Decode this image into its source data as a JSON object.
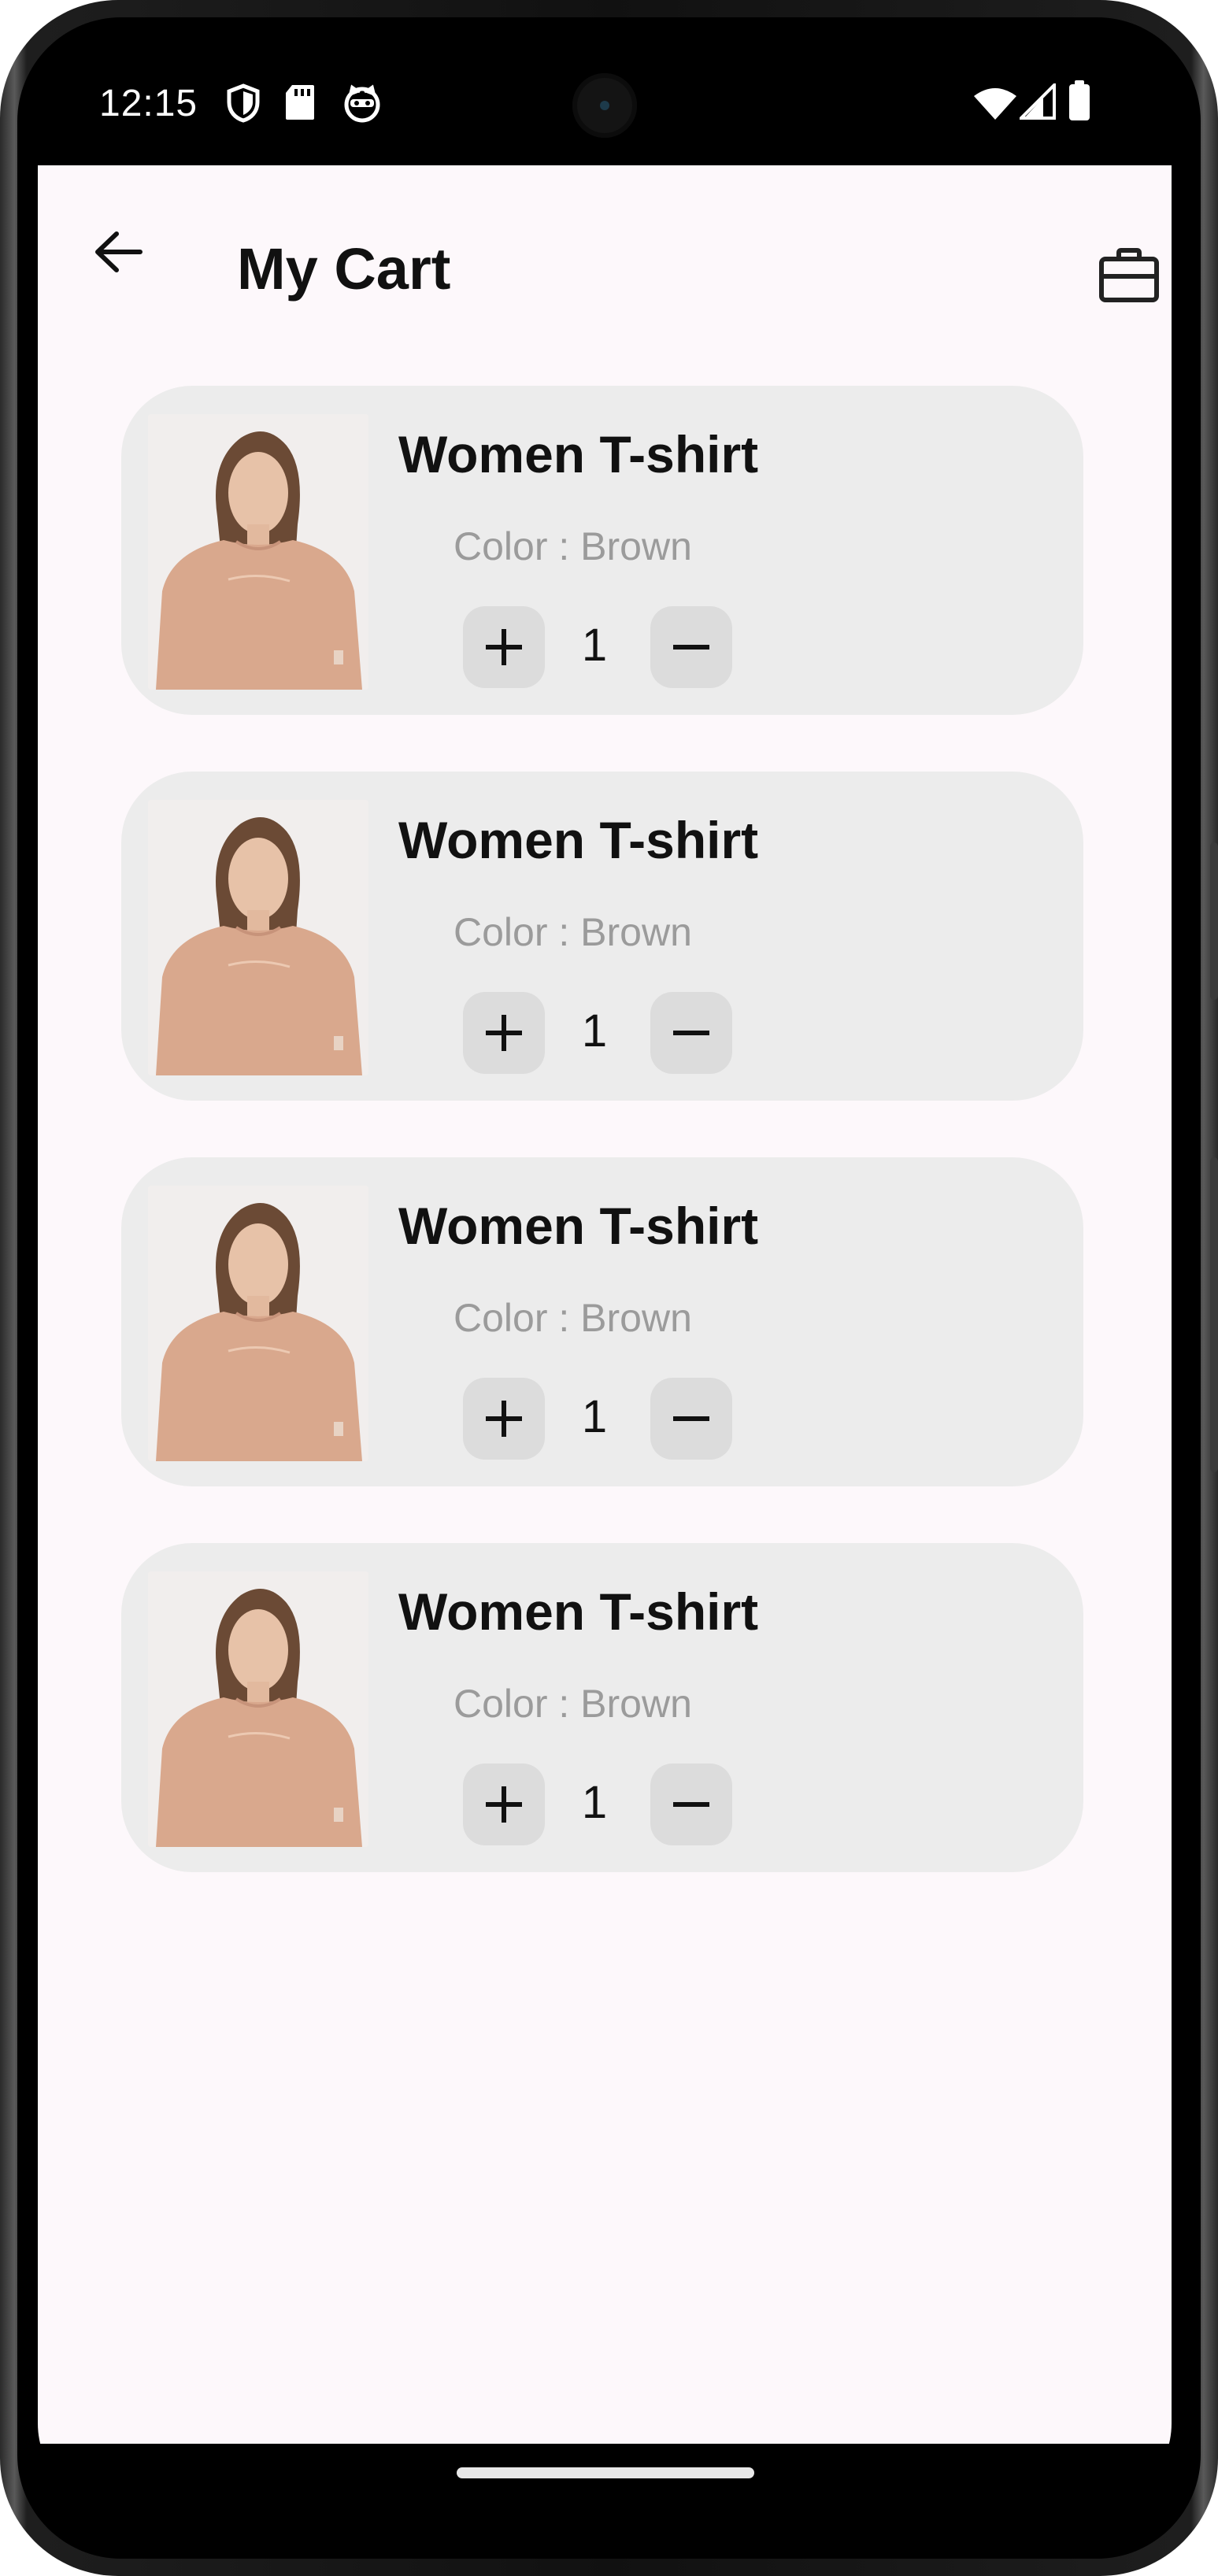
{
  "status_bar": {
    "time": "12:15",
    "left_icons": [
      "shield-icon",
      "sd-card-icon",
      "cat-face-icon"
    ],
    "right_icons": [
      "wifi-icon",
      "signal-icon",
      "battery-icon"
    ]
  },
  "header": {
    "title": "My Cart",
    "back_icon": "arrow-left-icon",
    "action_icon": "briefcase-icon"
  },
  "cart": {
    "items": [
      {
        "name": "Women T-shirt",
        "color_label": "Color : Brown",
        "quantity": "1"
      },
      {
        "name": "Women T-shirt",
        "color_label": "Color : Brown",
        "quantity": "1"
      },
      {
        "name": "Women T-shirt",
        "color_label": "Color : Brown",
        "quantity": "1"
      },
      {
        "name": "Women T-shirt",
        "color_label": "Color : Brown",
        "quantity": "1"
      }
    ]
  },
  "colors": {
    "background": "#fdf8fb",
    "card": "#ececec",
    "qty_button": "#dcdcdc",
    "muted_text": "#9b9b9b",
    "tshirt": "#d9a88d"
  }
}
